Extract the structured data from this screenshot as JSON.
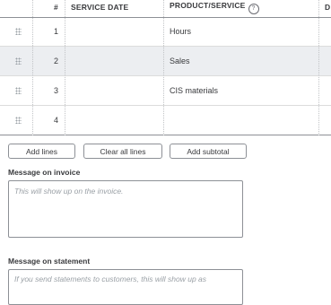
{
  "table": {
    "headers": {
      "num": "#",
      "service_date": "SERVICE DATE",
      "product_service": "PRODUCT/SERVICE",
      "help": "?",
      "next": "D"
    },
    "rows": [
      {
        "num": "1",
        "service_date": "",
        "product": "Hours"
      },
      {
        "num": "2",
        "service_date": "",
        "product": "Sales"
      },
      {
        "num": "3",
        "service_date": "",
        "product": "CIS materials"
      },
      {
        "num": "4",
        "service_date": "",
        "product": ""
      }
    ]
  },
  "buttons": {
    "add_lines": "Add lines",
    "clear_all_lines": "Clear all lines",
    "add_subtotal": "Add subtotal"
  },
  "message_invoice": {
    "label": "Message on invoice",
    "placeholder": "This will show up on the invoice."
  },
  "message_statement": {
    "label": "Message on statement",
    "placeholder": "If you send statements to customers, this will show up as"
  }
}
